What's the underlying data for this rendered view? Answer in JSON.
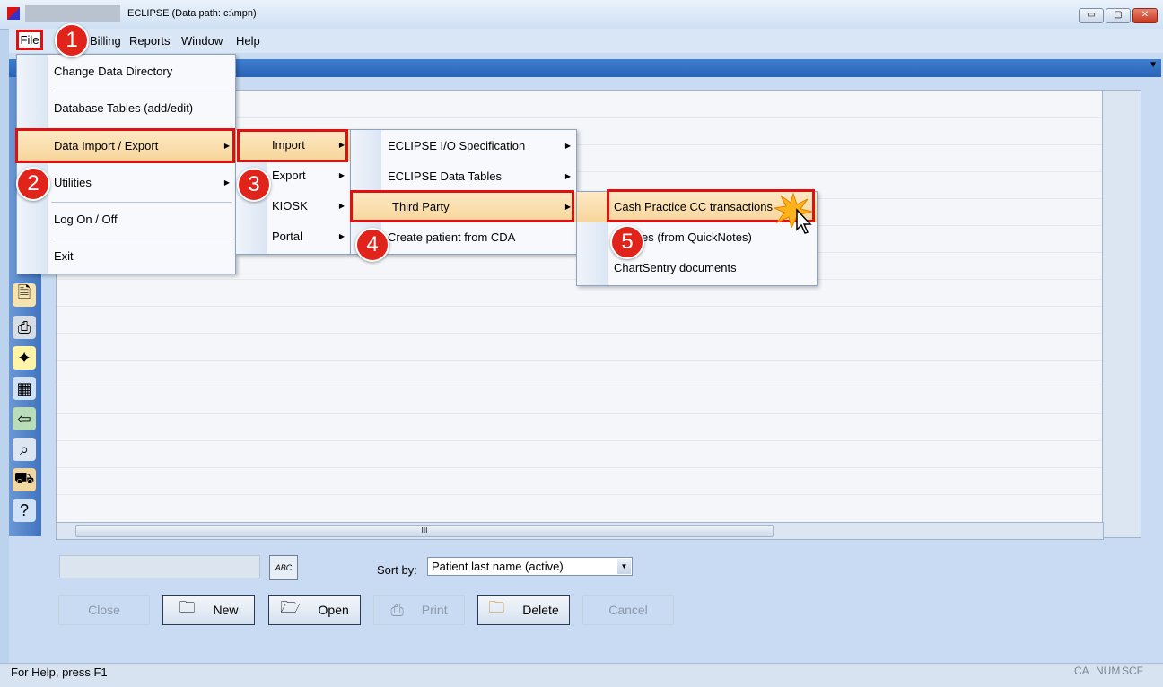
{
  "window": {
    "title": "ECLIPSE (Data path: c:\\mpn)",
    "controls": {
      "minimize": "▭",
      "restore": "▢",
      "close": "✕"
    }
  },
  "menubar": {
    "file": "File",
    "billing": "Billing",
    "reports": "Reports",
    "window": "Window",
    "help": "Help"
  },
  "file_menu": {
    "items": [
      "Change Data Directory",
      "Database Tables (add/edit)",
      "Data Import / Export",
      "Utilities",
      "Log On / Off",
      "Exit"
    ]
  },
  "import_export_menu": {
    "items": [
      "Import",
      "Export",
      "KIOSK",
      "Portal"
    ]
  },
  "import_menu": {
    "items": [
      "ECLIPSE I/O Specification",
      "ECLIPSE Data Tables",
      "Third Party",
      "Create patient from CDA"
    ]
  },
  "third_party_menu": {
    "items": [
      "Cash Practice CC transactions",
      "es (from QuickNotes)",
      "ChartSentry documents"
    ]
  },
  "callouts": [
    "1",
    "2",
    "3",
    "4",
    "5"
  ],
  "bottom": {
    "abc_label": "ABC",
    "sort_label": "Sort by:",
    "sort_value": "Patient last name (active)",
    "buttons": {
      "close": "Close",
      "new": "New",
      "open": "Open",
      "print": "Print",
      "delete": "Delete",
      "cancel": "Cancel"
    }
  },
  "scroll": {
    "grip": "III"
  },
  "status": {
    "help_text": "For Help, press F1",
    "indicators": [
      "CA",
      "NUM",
      "SCF"
    ]
  },
  "colors": {
    "highlight": "#f7d59a",
    "callout_red": "#e0241b",
    "accent_blue": "#2a63b6"
  },
  "icons": [
    "app-icon",
    "folder-icon",
    "open-folder-icon",
    "printer-icon",
    "delete-folder-icon",
    "abc-icon",
    "cursor-icon"
  ]
}
